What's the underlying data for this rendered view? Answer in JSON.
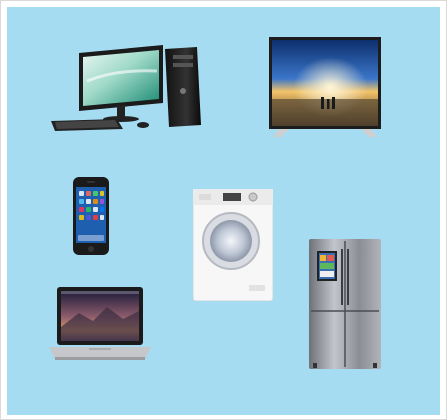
{
  "scene": {
    "background_color": "#a6dcf2",
    "items": [
      {
        "name": "desktop-computer-icon"
      },
      {
        "name": "flat-tv-icon"
      },
      {
        "name": "smartphone-icon"
      },
      {
        "name": "washing-machine-icon"
      },
      {
        "name": "refrigerator-icon"
      },
      {
        "name": "laptop-icon"
      }
    ]
  }
}
